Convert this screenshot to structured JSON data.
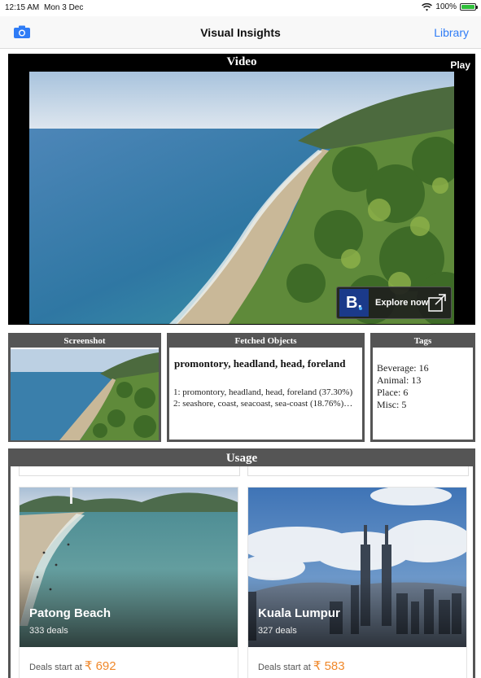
{
  "status_bar": {
    "time": "12:15 AM",
    "date": "Mon 3 Dec",
    "battery": "100%"
  },
  "nav": {
    "title": "Visual Insights",
    "library_label": "Library",
    "camera_icon": "camera-icon"
  },
  "video": {
    "title": "Video",
    "play_label": "Play",
    "explore_label": "Explore now",
    "brand_letter": "B."
  },
  "screenshot": {
    "title": "Screenshot"
  },
  "fetched": {
    "title": "Fetched Objects",
    "primary": "promontory, headland, head, foreland",
    "items": [
      "1: promontory, headland, head, foreland (37.30%)",
      "2: seashore, coast, seacoast, sea-coast (18.76%)…"
    ]
  },
  "tags": {
    "title": "Tags",
    "items": [
      "Beverage: 16",
      "Animal: 13",
      "Place: 6",
      "Misc: 5"
    ]
  },
  "usage": {
    "title": "Usage",
    "cards": [
      {
        "name": "Patong Beach",
        "deals": "333 deals",
        "price_prefix": "Deals start at",
        "price": "₹ 692"
      },
      {
        "name": "Kuala Lumpur",
        "deals": "327 deals",
        "price_prefix": "Deals start at",
        "price": "₹ 583"
      }
    ]
  },
  "colors": {
    "accent": "#2f7cf6",
    "panel_header": "#555555",
    "price": "#f0882a",
    "brand": "#1b3a8a"
  }
}
